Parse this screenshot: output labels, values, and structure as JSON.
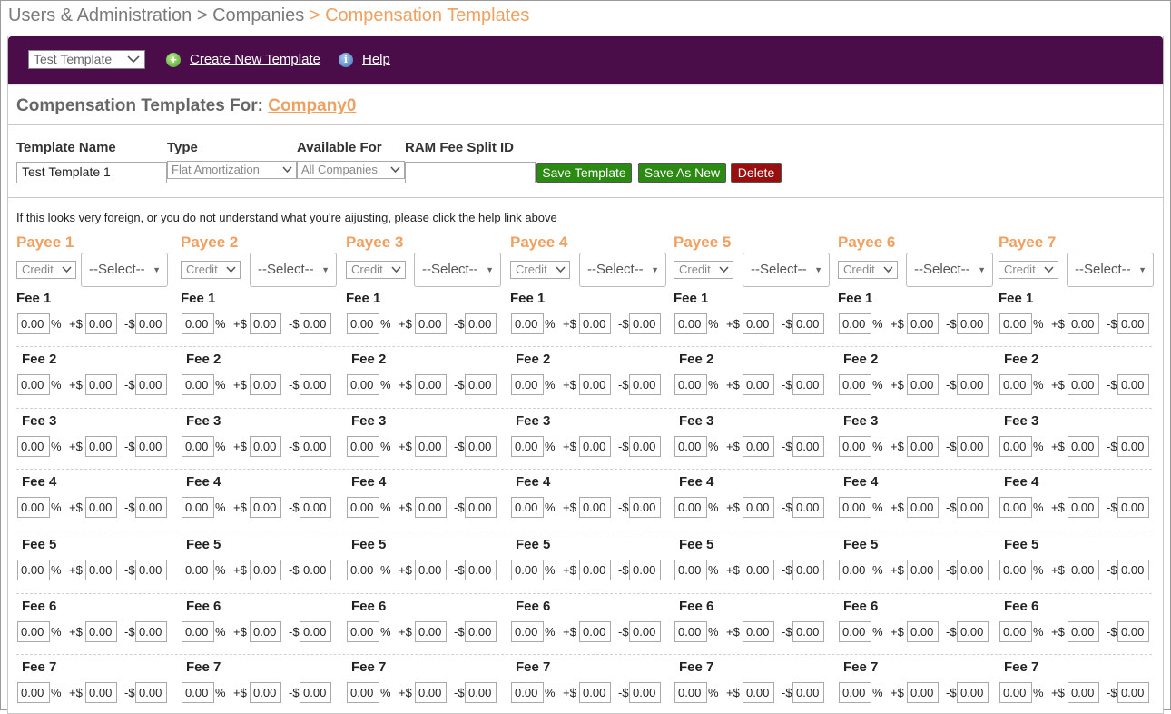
{
  "breadcrumb": {
    "part1": "Users & Administration",
    "sep1": " > ",
    "part2": "Companies",
    "sep2": " > ",
    "current": "Compensation Templates"
  },
  "toolbar": {
    "template_select": "Test Template",
    "create_label": "Create New Template",
    "help_label": "Help"
  },
  "company": {
    "title_prefix": "Compensation Templates For: ",
    "name": "Company0"
  },
  "form": {
    "template_name_label": "Template Name",
    "type_label": "Type",
    "available_label": "Available For",
    "ram_label": "RAM Fee Split ID",
    "template_name_value": "Test Template 1",
    "type_value": "Flat Amortization",
    "available_value": "All Companies",
    "ram_value": "",
    "save_label": "Save Template",
    "save_new_label": "Save As New",
    "delete_label": "Delete"
  },
  "help_text": "If this looks very foreign, or you do not understand what you're aijusting, please click the help link above",
  "payees": [
    {
      "title": "Payee 1",
      "credit": "Credit",
      "select": "--Select--"
    },
    {
      "title": "Payee 2",
      "credit": "Credit",
      "select": "--Select--"
    },
    {
      "title": "Payee 3",
      "credit": "Credit",
      "select": "--Select--"
    },
    {
      "title": "Payee 4",
      "credit": "Credit",
      "select": "--Select--"
    },
    {
      "title": "Payee 5",
      "credit": "Credit",
      "select": "--Select--"
    },
    {
      "title": "Payee  6",
      "credit": "Credit",
      "select": "--Select--"
    },
    {
      "title": "Payee 7",
      "credit": "Credit",
      "select": "--Select--"
    }
  ],
  "fee_labels": [
    "Fee 1",
    "Fee 2",
    "Fee 3",
    "Fee 4",
    "Fee 5",
    "Fee 6",
    "Fee 7"
  ],
  "fee_values": {
    "percent": "0.00",
    "plus": "0.00",
    "minus": "0.00"
  },
  "fee_symbols": {
    "percent_sign": "%",
    "plus_prefix": "+$",
    "minus_prefix": "-$"
  }
}
